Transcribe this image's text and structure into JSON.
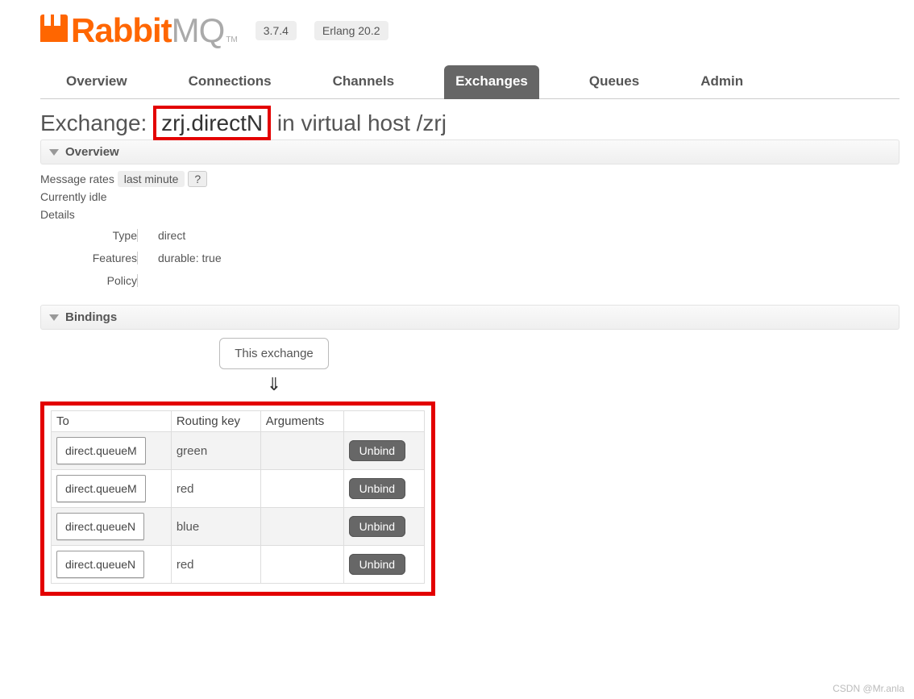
{
  "header": {
    "logo_rabbit": "Rabbit",
    "logo_mq": "MQ",
    "logo_tm": "TM",
    "version": "3.7.4",
    "erlang": "Erlang 20.2"
  },
  "tabs": {
    "overview": "Overview",
    "connections": "Connections",
    "channels": "Channels",
    "exchanges": "Exchanges",
    "queues": "Queues",
    "admin": "Admin"
  },
  "title": {
    "prefix": "Exchange: ",
    "name": "zrj.directN",
    "mid": " in virtual host ",
    "vhost": "/zrj"
  },
  "sections": {
    "overview": "Overview",
    "bindings": "Bindings"
  },
  "rates": {
    "label": "Message rates",
    "range": "last minute",
    "help": "?",
    "idle": "Currently idle"
  },
  "details": {
    "heading": "Details",
    "type_k": "Type",
    "type_v": "direct",
    "feat_k": "Features",
    "feat_v": "durable: true",
    "policy_k": "Policy",
    "policy_v": ""
  },
  "bindbox": {
    "this_exchange": "This exchange",
    "arrow": "⇓",
    "cols": {
      "to": "To",
      "rkey": "Routing key",
      "args": "Arguments"
    },
    "unbind": "Unbind",
    "rows": [
      {
        "to": "direct.queueM",
        "rkey": "green",
        "args": ""
      },
      {
        "to": "direct.queueM",
        "rkey": "red",
        "args": ""
      },
      {
        "to": "direct.queueN",
        "rkey": "blue",
        "args": ""
      },
      {
        "to": "direct.queueN",
        "rkey": "red",
        "args": ""
      }
    ]
  },
  "watermark": "CSDN @Mr.anla"
}
